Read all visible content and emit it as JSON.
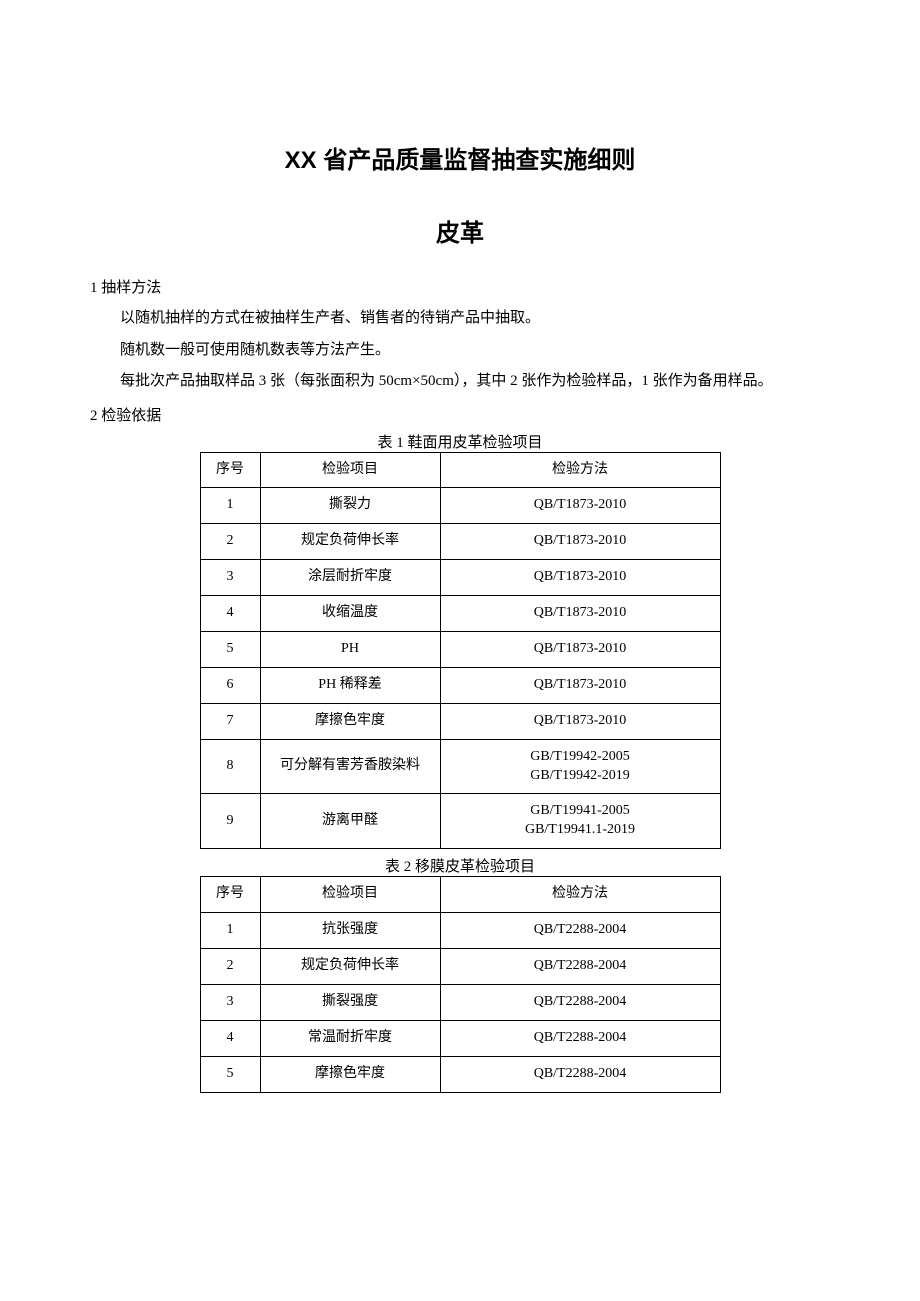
{
  "title_main": "XX 省产品质量监督抽查实施细则",
  "title_sub": "皮革",
  "section1_heading": "1 抽样方法",
  "section1_p1": "以随机抽样的方式在被抽样生产者、销售者的待销产品中抽取。",
  "section1_p2": "随机数一般可使用随机数表等方法产生。",
  "section1_p3": "每批次产品抽取样品 3 张（每张面积为 50cm×50cm），其中 2 张作为检验样品，1 张作为备用样品。",
  "section2_heading": "2 检验依据",
  "table1": {
    "caption": "表 1 鞋面用皮革检验项目",
    "headers": [
      "序号",
      "检验项目",
      "检验方法"
    ],
    "rows": [
      [
        "1",
        "撕裂力",
        "QB/T1873-2010"
      ],
      [
        "2",
        "规定负荷伸长率",
        "QB/T1873-2010"
      ],
      [
        "3",
        "涂层耐折牢度",
        "QB/T1873-2010"
      ],
      [
        "4",
        "收缩温度",
        "QB/T1873-2010"
      ],
      [
        "5",
        "PH",
        "QB/T1873-2010"
      ],
      [
        "6",
        "PH 稀释差",
        "QB/T1873-2010"
      ],
      [
        "7",
        "摩擦色牢度",
        "QB/T1873-2010"
      ],
      [
        "8",
        "可分解有害芳香胺染料",
        "GB/T19942-2005\nGB/T19942-2019"
      ],
      [
        "9",
        "游离甲醛",
        "GB/T19941-2005\nGB/T19941.1-2019"
      ]
    ]
  },
  "table2": {
    "caption": "表 2 移膜皮革检验项目",
    "headers": [
      "序号",
      "检验项目",
      "检验方法"
    ],
    "rows": [
      [
        "1",
        "抗张强度",
        "QB/T2288-2004"
      ],
      [
        "2",
        "规定负荷伸长率",
        "QB/T2288-2004"
      ],
      [
        "3",
        "撕裂强度",
        "QB/T2288-2004"
      ],
      [
        "4",
        "常温耐折牢度",
        "QB/T2288-2004"
      ],
      [
        "5",
        "摩擦色牢度",
        "QB/T2288-2004"
      ]
    ]
  }
}
